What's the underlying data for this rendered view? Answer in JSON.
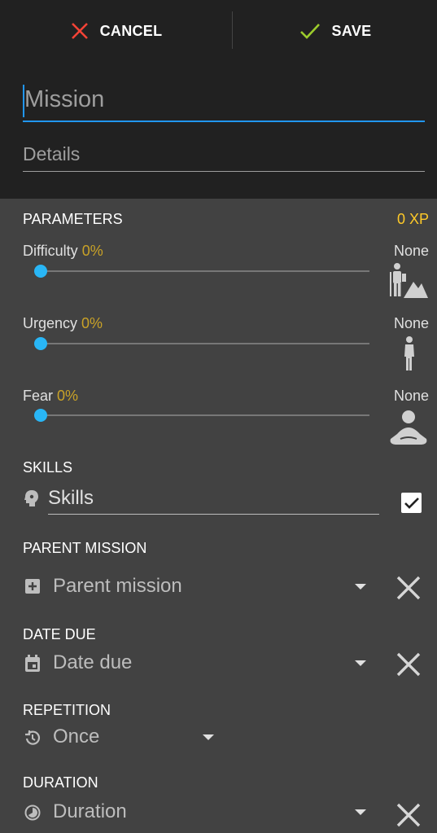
{
  "toolbar": {
    "cancel_label": "CANCEL",
    "save_label": "SAVE"
  },
  "form": {
    "title_placeholder": "Mission",
    "details_placeholder": "Details"
  },
  "parameters": {
    "heading": "PARAMETERS",
    "xp": "0 XP",
    "difficulty": {
      "label": "Difficulty",
      "percent": "0%",
      "value": 0,
      "level": "None"
    },
    "urgency": {
      "label": "Urgency",
      "percent": "0%",
      "value": 0,
      "level": "None"
    },
    "fear": {
      "label": "Fear",
      "percent": "0%",
      "value": 0,
      "level": "None"
    }
  },
  "skills": {
    "heading": "SKILLS",
    "placeholder": "Skills",
    "checked": true
  },
  "parent_mission": {
    "heading": "PARENT MISSION",
    "placeholder": "Parent mission"
  },
  "date_due": {
    "heading": "DATE DUE",
    "placeholder": "Date due"
  },
  "repetition": {
    "heading": "REPETITION",
    "value": "Once"
  },
  "duration": {
    "heading": "DURATION",
    "placeholder": "Duration"
  },
  "colors": {
    "accent": "#2196f3",
    "thumb": "#29b6f6",
    "xp": "#ffca28",
    "percent": "#c9a227",
    "cancel": "#f44336",
    "save": "#9ccc2c"
  },
  "icons": [
    "close-icon",
    "check-icon",
    "hiker-icon",
    "walking-icon",
    "meditation-icon",
    "brain-icon",
    "add-box-icon",
    "calendar-icon",
    "history-icon",
    "timelapse-icon"
  ]
}
